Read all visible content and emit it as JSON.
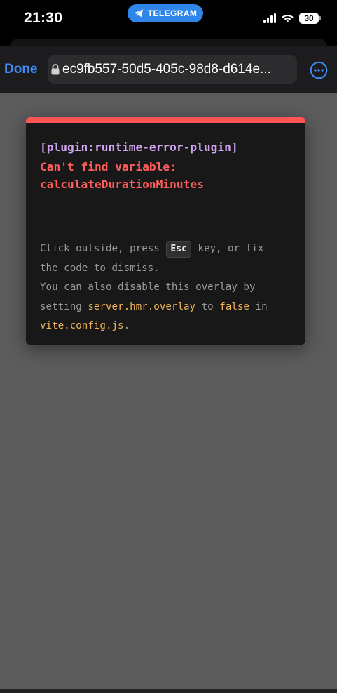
{
  "status_bar": {
    "time": "21:30",
    "pill_label": "TELEGRAM",
    "battery": "30"
  },
  "browser": {
    "done_label": "Done",
    "url": "ec9fb557-50d5-405c-98d8-d614e..."
  },
  "overlay": {
    "plugin": "[plugin:runtime-error-plugin]",
    "message_line1": "Can't find variable:",
    "message_line2": "calculateDurationMinutes",
    "tip": {
      "part1": "Click outside, press ",
      "key": "Esc",
      "part2": " key, or fix",
      "line2": "the code to dismiss.",
      "line3": "You can also disable this overlay by",
      "line4_prefix": "setting ",
      "line4_code1": "server.hmr.overlay",
      "line4_mid": " to ",
      "line4_code2": "false",
      "line4_suffix": " in",
      "line5_code": "vite.config.js",
      "line5_suffix": "."
    }
  },
  "colors": {
    "accent": "#3d8bf6",
    "error_bar": "#ff5555",
    "plugin_text": "#cfa3f0",
    "error_text": "#ff5c5c",
    "code_text": "#f0b35a",
    "page_background": "#5c5c5c"
  }
}
